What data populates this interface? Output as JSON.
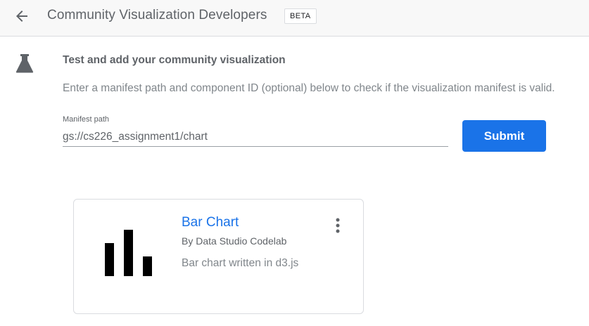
{
  "header": {
    "back_icon": "arrow-back-icon",
    "title": "Community Visualization Developers",
    "badge": "BETA"
  },
  "section": {
    "icon": "flask-icon",
    "title": "Test and add your community visualization",
    "description": "Enter a manifest path and component ID (optional) below to check if the visualization manifest is valid."
  },
  "form": {
    "manifest_label": "Manifest path",
    "manifest_value": "gs://cs226_assignment1/chart",
    "submit_label": "Submit"
  },
  "card": {
    "thumbnail_icon": "bar-chart-icon",
    "title": "Bar Chart",
    "author": "By Data Studio Codelab",
    "description": "Bar chart written in d3.js",
    "menu_icon": "more-vert-icon"
  },
  "colors": {
    "accent": "#1a73e8",
    "header_bg": "#f8f8f8"
  }
}
